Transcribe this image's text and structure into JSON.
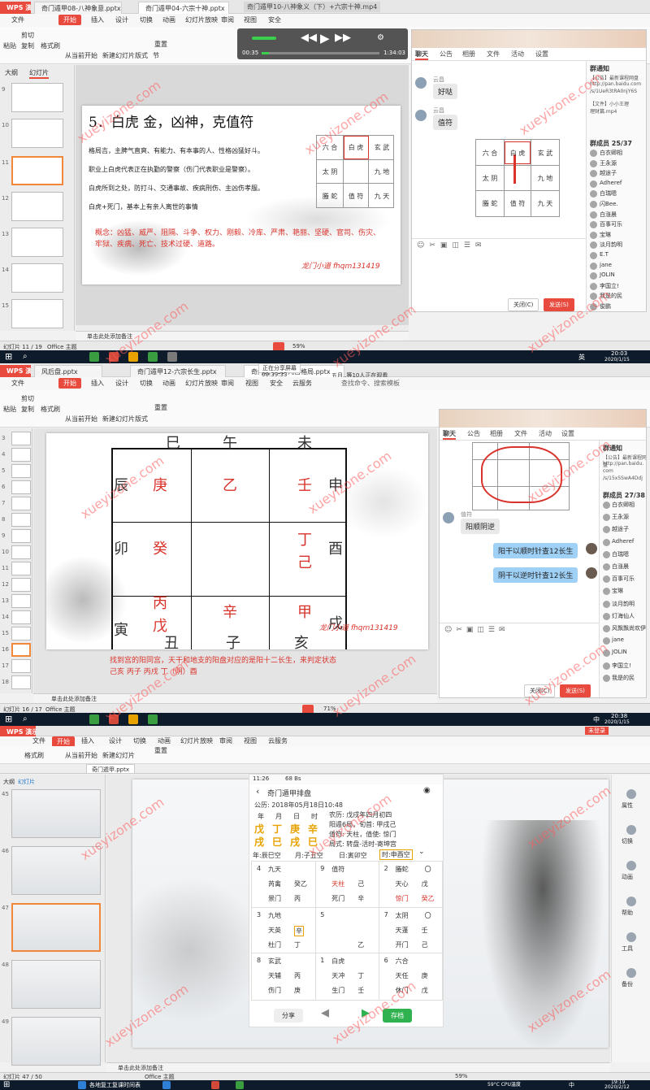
{
  "panel1": {
    "app_badge": "WPS 演示",
    "tabs": [
      "奇门遁甲08-八神象意.pptx",
      "奇门遁甲04-六宗十神.pptx"
    ],
    "window_title": "奇门遁甲10-八神象义（下）+六宗十神.mp4",
    "menus": [
      "文件",
      "开始",
      "插入",
      "设计",
      "切换",
      "动画",
      "幻灯片放映",
      "审阅",
      "视图",
      "安全"
    ],
    "active_menu": "开始",
    "ribbon": {
      "paste": "粘贴",
      "cut": "剪切",
      "copy": "复制",
      "format_painter": "格式刷",
      "from_current": "从当前开始",
      "new_slide": "新建幻灯片",
      "layout": "版式",
      "section": "节",
      "reset": "重置"
    },
    "video": {
      "time_current": "00:35",
      "time_total": "1:34:03"
    },
    "outline_tabs": [
      "大纲",
      "幻灯片"
    ],
    "thumb_numbers": [
      "9",
      "10",
      "11",
      "12",
      "13",
      "14",
      "15"
    ],
    "slide": {
      "title": "5．白虎  金，凶神，克值符",
      "paragraphs": [
        "格局吉，主脾气直爽、有能力、有本事的人、性格凶猛好斗。",
        "职业上白虎代表正在执勤的警察（伤门代表职业是警察）。",
        "白虎所到之处，防打斗、交通事故、疾病刑伤、主凶伤孝服。",
        "白虎+死门，基本上有亲人离世的事情"
      ],
      "concept": "概念：凶猛、威严、阻隔、斗争、权力、刚毅、冷库、严肃、艳丽、坚硬、官司、伤灾、牢狱、疾病、死亡、技术过硬、道路。",
      "signature": "龙门小道  fhqm131419",
      "grid": [
        [
          "六 合",
          "白 虎",
          "玄 武"
        ],
        [
          "太 阴",
          "",
          "九 地"
        ],
        [
          "螣 蛇",
          "值 符",
          "九 天"
        ]
      ]
    },
    "notes_placeholder": "单击此处添加备注",
    "status": {
      "slide_count": "幻灯片 11 / 19",
      "theme": "Office 主题",
      "zoom": "59%"
    },
    "chat": {
      "tabs": [
        "聊天",
        "公告",
        "相册",
        "文件",
        "活动",
        "设置"
      ],
      "messages": [
        {
          "sender": "云昌",
          "text": "好哒"
        },
        {
          "sender": "云昌",
          "text": "值符"
        }
      ],
      "notice_title": "群通知",
      "notice_lines": [
        "【公告】最新课程网盘",
        "http://pan.baidu.com",
        "/s/1UeR3tRA0njY6S",
        "【文件】小小王理",
        "理财篇.mp4"
      ],
      "members_title": "群成员 25/37",
      "members": [
        "白衣卿相",
        "王永源",
        "越途子",
        "Adheref",
        "白瑞嗯",
        "闪Bee.",
        "白涨晨",
        "百事可乐",
        "宝琳",
        "淡月韵明",
        "E.T",
        "jane",
        "JOLIN",
        "李国立!",
        "我是的民",
        "俊鹏"
      ],
      "close_btn": "关闭(C)",
      "send_btn": "发送(S)"
    },
    "tray": {
      "time": "20:03",
      "date": "2020/1/15",
      "lang": "英"
    }
  },
  "panel2": {
    "app_badge": "WPS 演示",
    "tabs": [
      "风后盘.pptx",
      "奇门遁甲12-六宗长生.pptx",
      "奇门遁甲13-九宫格局.pptx"
    ],
    "share_notice": "正在分享屏幕",
    "share_time": "00:39:33",
    "viewers": "五月..等10人正在观看",
    "menus": [
      "文件",
      "开始",
      "插入",
      "设计",
      "切换",
      "动画",
      "幻灯片放映",
      "审阅",
      "视图",
      "安全",
      "云服务"
    ],
    "active_menu": "开始",
    "search_cmd": "查找命令、搜索模板",
    "thumb_numbers": [
      "3",
      "4",
      "5",
      "6",
      "7",
      "8",
      "9",
      "10",
      "11",
      "12",
      "13",
      "14",
      "15",
      "16",
      "17",
      "18"
    ],
    "slide": {
      "top_branches": [
        "巳",
        "午",
        "未"
      ],
      "left_branches": [
        "辰",
        "卯",
        "寅"
      ],
      "right_branches": [
        "申",
        "酉",
        "戌"
      ],
      "bottom_branches": [
        "丑",
        "子",
        "亥"
      ],
      "cells": [
        "庚",
        "乙",
        "壬",
        "癸",
        "",
        "丁己",
        "丙戊",
        "辛",
        "甲"
      ],
      "signature": "龙门小道  fhqm131419",
      "caption_line1": "找到宫的阳同宫，天干和地支的阳盘对应的是阳十二长生，来判定状态",
      "caption_line2": "己亥   丙子   丙戌   丁（阴）酉"
    },
    "notes_placeholder": "单击此处添加备注",
    "status": {
      "slide_count": "幻灯片 16 / 17",
      "theme": "Office 主题",
      "zoom": "71%"
    },
    "chat": {
      "tabs": [
        "聊天",
        "公告",
        "相册",
        "文件",
        "活动",
        "设置"
      ],
      "sender": "值符",
      "messages": [
        "阳顺阴逆",
        "阳干以顺时针查12长生",
        "阴干以逆时针查12长生"
      ],
      "notice_title": "群通知",
      "notice_lines": [
        "【公告】最新课程网盘",
        "http://pan.baidu.",
        "com",
        "/s/15x5SwA4Ddj"
      ],
      "members_title": "群成员 27/38",
      "members": [
        "白衣卿相",
        "王永源",
        "越途子",
        "Adheref",
        "白瑞嗯",
        "白涨晨",
        "百事可乐",
        "宝琳",
        "淡月韵明",
        "灯海仙人",
        "风飘飘尚欢伊",
        "jane",
        "JOLIN",
        "李国立!",
        "我是的民"
      ],
      "close_btn": "关闭(C)",
      "send_btn": "发送(S)"
    },
    "tray": {
      "time": "20:38",
      "date": "2020/1/15",
      "lang": "中"
    }
  },
  "panel3": {
    "app_badge": "WPS 演示",
    "login": "未登录",
    "menus": [
      "文件",
      "开始",
      "插入",
      "设计",
      "切换",
      "动画",
      "幻灯片放映",
      "审阅",
      "视图",
      "云服务"
    ],
    "active_menu": "开始",
    "tab": "奇门遁甲.pptx",
    "outline_tabs": [
      "大纲",
      "幻灯片"
    ],
    "thumb_numbers": [
      "45",
      "46",
      "47",
      "48",
      "49"
    ],
    "phone": {
      "status_time": "11:26",
      "status_right": "68 Bs",
      "title": "奇门遁甲排盘",
      "date_line": "公历: 2018年05月18日10:48",
      "ymdh_labels": [
        "年",
        "月",
        "日",
        "时"
      ],
      "stems": [
        "戊",
        "丁",
        "庚",
        "辛"
      ],
      "branches": [
        "戌",
        "巳",
        "戌",
        "巳"
      ],
      "lunar": "农历: 戊戌年四月初四",
      "ju": "阳遁6局，旬首: 甲戌己",
      "zhifu": "值符: 天柱，值使: 惊门",
      "geju": "局式: 转盘-活时-寄坤宫",
      "kong_year": "年:辰巳空",
      "kong_month": "月:子丑空",
      "kong_day": "日:寅卯空",
      "kong_hour": "时:申酉空",
      "palaces": [
        {
          "num": "4",
          "god": "九天",
          "mark": "",
          "star": "芮禽",
          "star_stem": "癸乙",
          "door": "景门",
          "door_stem": "丙"
        },
        {
          "num": "9",
          "god": "值符",
          "mark": "",
          "star": "天柱",
          "star_stem": "己",
          "door": "死门",
          "door_stem": "辛"
        },
        {
          "num": "2",
          "god": "螣蛇",
          "mark": "〇",
          "star": "天心",
          "star_stem": "戊",
          "door": "惊门",
          "door_stem": "癸乙"
        },
        {
          "num": "3",
          "god": "九地",
          "mark": "",
          "star": "天英",
          "star_stem": "辛",
          "door": "杜门",
          "door_stem": "丁"
        },
        {
          "num": "5",
          "god": "",
          "mark": "",
          "star": "",
          "star_stem": "",
          "door": "",
          "door_stem": "乙"
        },
        {
          "num": "7",
          "god": "太阴",
          "mark": "〇",
          "star": "天蓬",
          "star_stem": "壬",
          "door": "开门",
          "door_stem": "己"
        },
        {
          "num": "8",
          "god": "玄武",
          "mark": "",
          "star": "天辅",
          "star_stem": "丙",
          "door": "伤门",
          "door_stem": "庚"
        },
        {
          "num": "1",
          "god": "白虎",
          "mark": "",
          "star": "天冲",
          "star_stem": "丁",
          "door": "生门",
          "door_stem": "壬"
        },
        {
          "num": "6",
          "god": "六合",
          "mark": "",
          "star": "天任",
          "star_stem": "庚",
          "door": "休门",
          "door_stem": "戊"
        }
      ],
      "share_btn": "分享",
      "save_btn": "存档"
    },
    "right_pane": [
      "属性",
      "切换",
      "动画",
      "帮助",
      "工具",
      "备份"
    ],
    "notes_placeholder": "单击此处添加备注",
    "status": {
      "slide_count": "幻灯片 47 / 50",
      "theme": "Office 主题",
      "zoom": "59%"
    },
    "taskbar_item": "各地复工复课时间表",
    "tray": {
      "time": "19:19",
      "date": "2020/2/12",
      "weather": "59°C CPU温度",
      "lang": "中"
    }
  },
  "watermark": "xueyizone.com",
  "colors": {
    "wps_red": "#e84a3e",
    "slide_red": "#d9322a",
    "accent_orange": "#f0873a",
    "stem_orange": "#e8a200",
    "blue_bubble": "#9fd1f7",
    "save_green": "#2fb24f"
  }
}
